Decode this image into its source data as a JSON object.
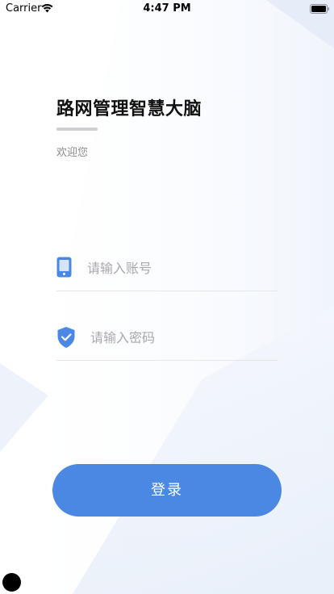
{
  "status_bar": {
    "carrier": "Carrier",
    "time": "4:47 PM",
    "icons": [
      "wifi-icon",
      "battery-icon"
    ]
  },
  "header": {
    "title": "路网管理智慧大脑",
    "subtitle": "欢迎您"
  },
  "form": {
    "account_placeholder": "请输入账号",
    "account_value": "",
    "account_icon": "phone-icon",
    "password_placeholder": "请输入密码",
    "password_value": "",
    "password_icon": "shield-check-icon"
  },
  "actions": {
    "login_label": "登录"
  },
  "colors": {
    "accent": "#4b88e3",
    "background_tint": "#eef3fb"
  }
}
